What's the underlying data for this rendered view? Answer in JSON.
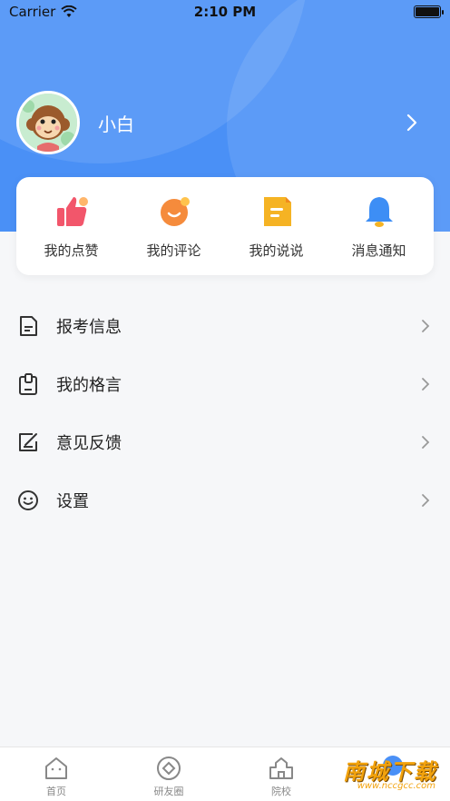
{
  "status_bar": {
    "carrier": "Carrier",
    "time": "2:10 PM"
  },
  "profile": {
    "username": "小白"
  },
  "quick_actions": [
    {
      "label": "我的点赞",
      "icon": "thumbs-up-icon",
      "color": "#f2566b"
    },
    {
      "label": "我的评论",
      "icon": "comment-bubble-icon",
      "color": "#f58b3c"
    },
    {
      "label": "我的说说",
      "icon": "note-icon",
      "color": "#f5b324"
    },
    {
      "label": "消息通知",
      "icon": "bell-icon",
      "color": "#3d8ef5"
    }
  ],
  "menu": [
    {
      "label": "报考信息",
      "icon": "document-icon"
    },
    {
      "label": "我的格言",
      "icon": "clipboard-icon"
    },
    {
      "label": "意见反馈",
      "icon": "feedback-edit-icon"
    },
    {
      "label": "设置",
      "icon": "smiley-settings-icon"
    }
  ],
  "tabs": [
    {
      "label": "首页",
      "icon": "home-icon"
    },
    {
      "label": "研友圈",
      "icon": "circle-friends-icon"
    },
    {
      "label": "院校",
      "icon": "school-icon"
    },
    {
      "label": "",
      "icon": "profile-icon"
    }
  ],
  "watermark": {
    "text": "南城下载",
    "sub": "www.nccgcc.com"
  },
  "colors": {
    "primary": "#4a90f6",
    "background": "#f6f7f9"
  }
}
